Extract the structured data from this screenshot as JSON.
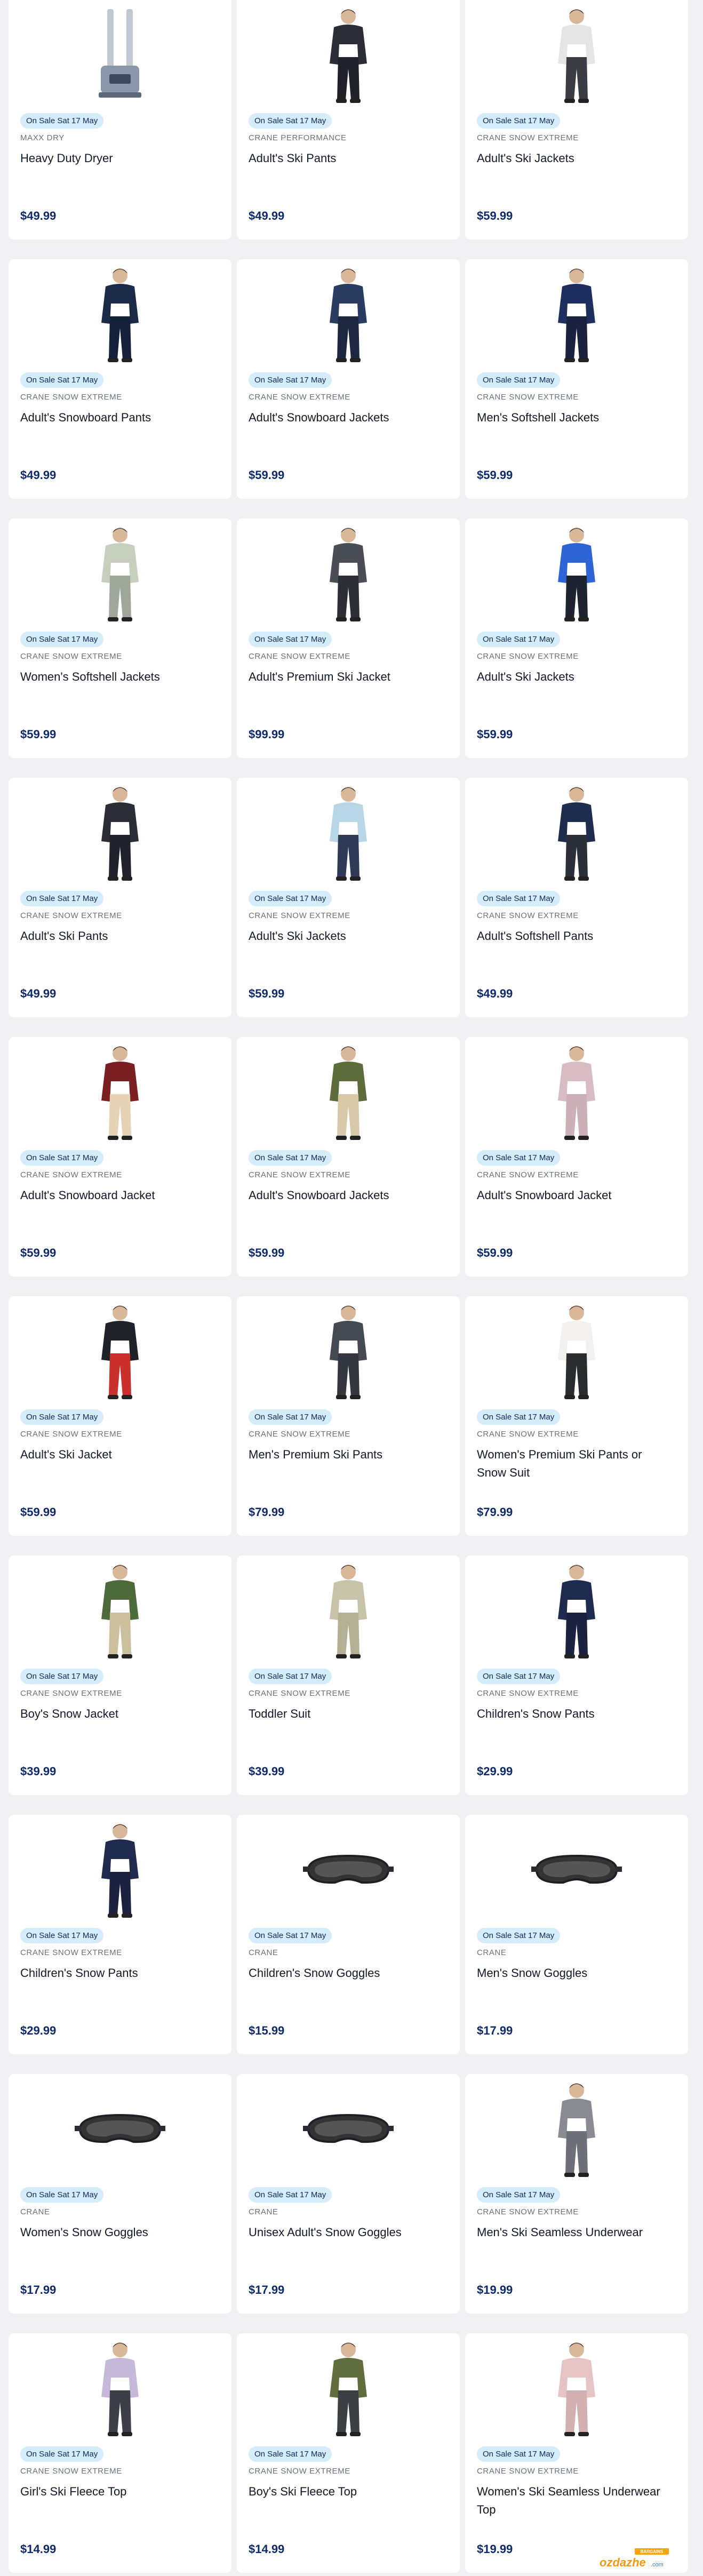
{
  "products": [
    {
      "badge": "On Sale Sat 17 May",
      "brand": "MAXX DRY",
      "name": "Heavy Duty Dryer",
      "price": "$49.99",
      "image": "boot-dryer-icon"
    },
    {
      "badge": "On Sale Sat 17 May",
      "brand": "CRANE PERFORMANCE",
      "name": "Adult's Ski Pants",
      "price": "$49.99",
      "image": "ski-pants-model-icon"
    },
    {
      "badge": "On Sale Sat 17 May",
      "brand": "CRANE SNOW EXTREME",
      "name": "Adult's Ski Jackets",
      "price": "$59.99",
      "image": "ski-jacket-model-icon"
    },
    {
      "badge": "On Sale Sat 17 May",
      "brand": "CRANE SNOW EXTREME",
      "name": "Adult's Snowboard Pants",
      "price": "$49.99",
      "image": "snowboard-pants-icon"
    },
    {
      "badge": "On Sale Sat 17 May",
      "brand": "CRANE SNOW EXTREME",
      "name": "Adult's Snowboard Jackets",
      "price": "$59.99",
      "image": "snowboard-jacket-model-icon"
    },
    {
      "badge": "On Sale Sat 17 May",
      "brand": "CRANE SNOW EXTREME",
      "name": "Men's Softshell Jackets",
      "price": "$59.99",
      "image": "softshell-jacket-model-icon"
    },
    {
      "badge": "On Sale Sat 17 May",
      "brand": "CRANE SNOW EXTREME",
      "name": "Women's Softshell Jackets",
      "price": "$59.99",
      "image": "softshell-jacket-model-icon"
    },
    {
      "badge": "On Sale Sat 17 May",
      "brand": "CRANE SNOW EXTREME",
      "name": "Adult's Premium Ski Jacket",
      "price": "$99.99",
      "image": "ski-jacket-model-icon"
    },
    {
      "badge": "On Sale Sat 17 May",
      "brand": "CRANE SNOW EXTREME",
      "name": "Adult's Ski Jackets",
      "price": "$59.99",
      "image": "ski-jacket-model-icon"
    },
    {
      "badge": "On Sale Sat 17 May",
      "brand": "CRANE SNOW EXTREME",
      "name": "Adult's Ski Pants",
      "price": "$49.99",
      "image": "ski-pants-model-icon"
    },
    {
      "badge": "On Sale Sat 17 May",
      "brand": "CRANE SNOW EXTREME",
      "name": "Adult's Ski Jackets",
      "price": "$59.99",
      "image": "ski-jacket-model-icon"
    },
    {
      "badge": "On Sale Sat 17 May",
      "brand": "CRANE SNOW EXTREME",
      "name": "Adult's Softshell Pants",
      "price": "$49.99",
      "image": "softshell-pants-model-icon"
    },
    {
      "badge": "On Sale Sat 17 May",
      "brand": "CRANE SNOW EXTREME",
      "name": "Adult's Snowboard Jacket",
      "price": "$59.99",
      "image": "snowboard-jacket-model-icon"
    },
    {
      "badge": "On Sale Sat 17 May",
      "brand": "CRANE SNOW EXTREME",
      "name": "Adult's Snowboard Jackets",
      "price": "$59.99",
      "image": "snowboard-jacket-model-icon"
    },
    {
      "badge": "On Sale Sat 17 May",
      "brand": "CRANE SNOW EXTREME",
      "name": "Adult's Snowboard Jacket",
      "price": "$59.99",
      "image": "snowboard-jacket-model-icon"
    },
    {
      "badge": "On Sale Sat 17 May",
      "brand": "CRANE SNOW EXTREME",
      "name": "Adult's Ski Jacket",
      "price": "$59.99",
      "image": "ski-jacket-model-icon"
    },
    {
      "badge": "On Sale Sat 17 May",
      "brand": "CRANE SNOW EXTREME",
      "name": "Men's Premium Ski Pants",
      "price": "$79.99",
      "image": "ski-pants-model-icon"
    },
    {
      "badge": "On Sale Sat 17 May",
      "brand": "CRANE SNOW EXTREME",
      "name": "Women's Premium Ski Pants or Snow Suit",
      "price": "$79.99",
      "image": "ski-pants-model-icon"
    },
    {
      "badge": "On Sale Sat 17 May",
      "brand": "CRANE SNOW EXTREME",
      "name": "Boy's Snow Jacket",
      "price": "$39.99",
      "image": "kids-jacket-model-icon"
    },
    {
      "badge": "On Sale Sat 17 May",
      "brand": "CRANE SNOW EXTREME",
      "name": "Toddler Suit",
      "price": "$39.99",
      "image": "toddler-suit-model-icon"
    },
    {
      "badge": "On Sale Sat 17 May",
      "brand": "CRANE SNOW EXTREME",
      "name": "Children's Snow Pants",
      "price": "$29.99",
      "image": "kids-pants-model-icon"
    },
    {
      "badge": "On Sale Sat 17 May",
      "brand": "CRANE SNOW EXTREME",
      "name": "Children's Snow Pants",
      "price": "$29.99",
      "image": "kids-pants-model-icon"
    },
    {
      "badge": "On Sale Sat 17 May",
      "brand": "CRANE",
      "name": "Children's Snow Goggles",
      "price": "$15.99",
      "image": "goggles-icon"
    },
    {
      "badge": "On Sale Sat 17 May",
      "brand": "CRANE",
      "name": "Men's Snow Goggles",
      "price": "$17.99",
      "image": "goggles-icon"
    },
    {
      "badge": "On Sale Sat 17 May",
      "brand": "CRANE",
      "name": "Women's Snow Goggles",
      "price": "$17.99",
      "image": "goggles-icon"
    },
    {
      "badge": "On Sale Sat 17 May",
      "brand": "CRANE",
      "name": "Unisex Adult's Snow Goggles",
      "price": "$17.99",
      "image": "goggles-icon"
    },
    {
      "badge": "On Sale Sat 17 May",
      "brand": "CRANE SNOW EXTREME",
      "name": "Men's Ski Seamless Underwear",
      "price": "$19.99",
      "image": "base-layer-model-icon"
    },
    {
      "badge": "On Sale Sat 17 May",
      "brand": "CRANE SNOW EXTREME",
      "name": "Girl's Ski Fleece Top",
      "price": "$14.99",
      "image": "kids-fleece-model-icon"
    },
    {
      "badge": "On Sale Sat 17 May",
      "brand": "CRANE SNOW EXTREME",
      "name": "Boy's Ski Fleece Top",
      "price": "$14.99",
      "image": "kids-fleece-model-icon"
    },
    {
      "badge": "On Sale Sat 17 May",
      "brand": "CRANE SNOW EXTREME",
      "name": "Women's Ski Seamless Underwear Top",
      "price": "$19.99",
      "image": "base-layer-model-icon"
    }
  ],
  "watermark": {
    "text": "ozdazhe",
    "suffix": ".com",
    "tag": "BARGAINS"
  },
  "colors": {
    "page_background": "#f1f1f3",
    "card_background": "#ffffff",
    "badge_background": "#d5ecfb",
    "badge_text": "#0b2a55",
    "brand_text": "#6b6f7a",
    "price_text": "#0f2a6b"
  }
}
